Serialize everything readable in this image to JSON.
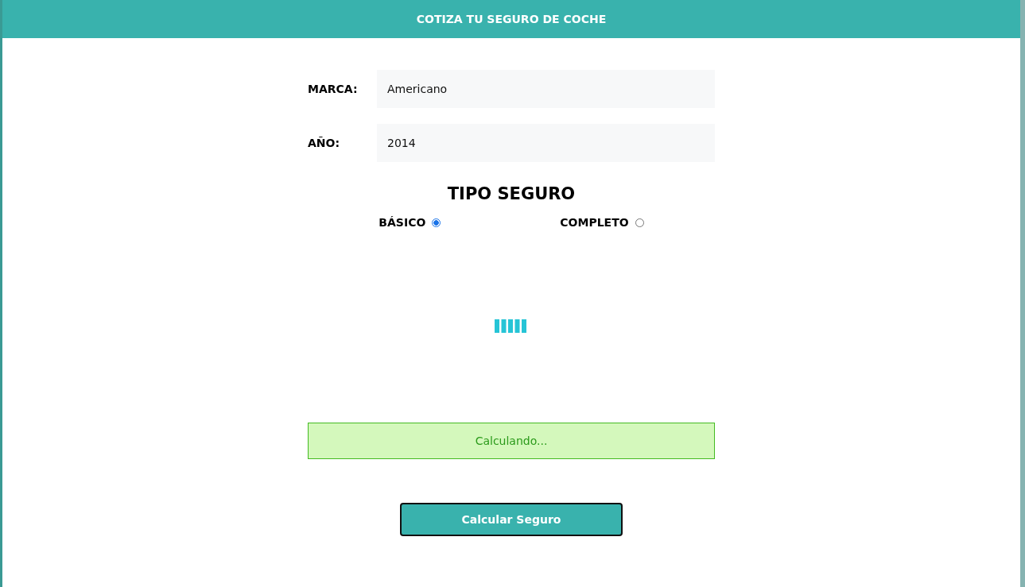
{
  "header": {
    "title": "COTIZA TU SEGURO DE COCHE"
  },
  "fields": [
    {
      "label": "MARCA:",
      "value": "Americano"
    },
    {
      "label": "AÑO:",
      "value": "2014"
    }
  ],
  "insurance_type": {
    "title": "TIPO SEGURO",
    "options": [
      {
        "label": "BÁSICO",
        "selected": true
      },
      {
        "label": "COMPLETO",
        "selected": false
      }
    ]
  },
  "message": {
    "text": "Calculando..."
  },
  "submit_button": {
    "label": "Calcular Seguro"
  }
}
